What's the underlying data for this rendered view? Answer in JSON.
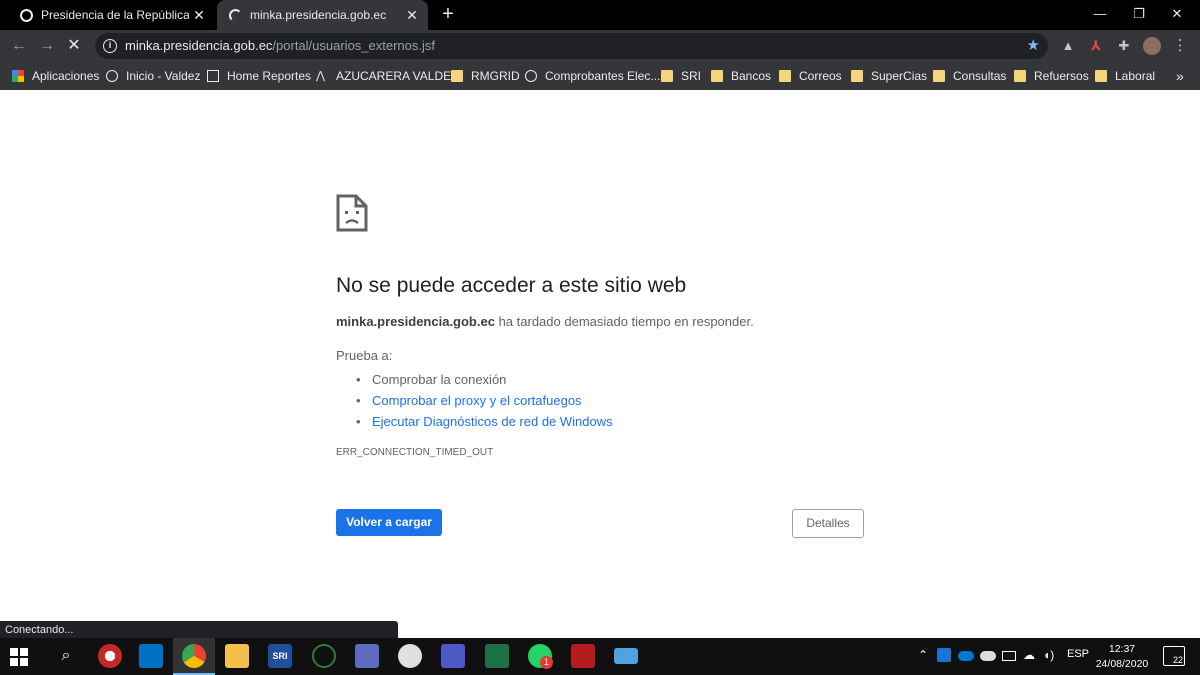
{
  "browser": {
    "tabs": [
      {
        "title": "Presidencia de la República del E",
        "active": false
      },
      {
        "title": "minka.presidencia.gob.ec",
        "active": true
      }
    ],
    "address": {
      "host": "minka.presidencia.gob.ec",
      "path": "/portal/usuarios_externos.jsf"
    },
    "bookmarks": [
      {
        "label": "Aplicaciones",
        "icon": "apps-grid-icon"
      },
      {
        "label": "Inicio - Valdez",
        "icon": "globe-icon"
      },
      {
        "label": "Home Reportes",
        "icon": "report-icon"
      },
      {
        "label": "AZUCARERA VALDE...",
        "icon": "azucarera-logo-icon"
      },
      {
        "label": "RMGRID",
        "icon": "folder-icon"
      },
      {
        "label": "Comprobantes Elec...",
        "icon": "globe-icon"
      },
      {
        "label": "SRI",
        "icon": "folder-icon"
      },
      {
        "label": "Bancos",
        "icon": "folder-icon"
      },
      {
        "label": "Correos",
        "icon": "folder-icon"
      },
      {
        "label": "SuperCias",
        "icon": "folder-icon"
      },
      {
        "label": "Consultas",
        "icon": "folder-icon"
      },
      {
        "label": "Refuersos",
        "icon": "folder-icon"
      },
      {
        "label": "Laboral",
        "icon": "folder-icon"
      }
    ],
    "status_text": "Conectando..."
  },
  "error_page": {
    "title": "No se puede acceder a este sitio web",
    "host": "minka.presidencia.gob.ec",
    "message": "ha tardado demasiado tiempo en responder.",
    "try_label": "Prueba a:",
    "suggestions": [
      {
        "text": "Comprobar la conexión",
        "link": false
      },
      {
        "text": "Comprobar el proxy y el cortafuegos",
        "link": true
      },
      {
        "text": "Ejecutar Diagnósticos de red de Windows",
        "link": true
      }
    ],
    "error_code": "ERR_CONNECTION_TIMED_OUT",
    "reload_label": "Volver a cargar",
    "details_label": "Detalles"
  },
  "taskbar": {
    "language": "ESP",
    "time": "12:37",
    "date": "24/08/2020",
    "notifications": "22",
    "whatsapp_badge": "1"
  },
  "colors": {
    "accent": "#1a73e8",
    "chrome_dark": "#202124",
    "toolbar": "#35363a"
  }
}
